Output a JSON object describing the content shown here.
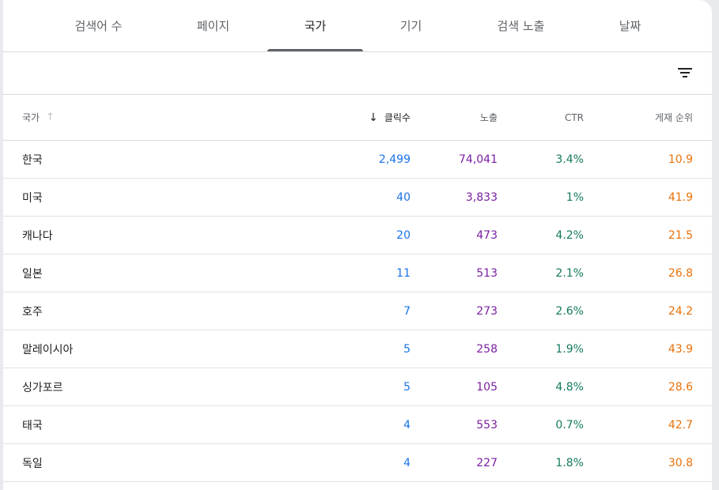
{
  "tabs": [
    {
      "label": "검색어 수"
    },
    {
      "label": "페이지"
    },
    {
      "label": "국가"
    },
    {
      "label": "기기"
    },
    {
      "label": "검색 노출"
    },
    {
      "label": "날짜"
    }
  ],
  "active_tab": "국가",
  "toolbar": {
    "filter_icon": "filter-list-icon"
  },
  "table": {
    "headers": {
      "country": "국가",
      "clicks": "클릭수",
      "impressions": "노출",
      "ctr": "CTR",
      "position": "게재 순위"
    },
    "colors": {
      "clicks": "#1a73e8",
      "impressions": "#7b1fa2",
      "ctr": "#137a5e",
      "position": "#e8710a"
    },
    "rows": [
      {
        "country": "한국",
        "clicks": "2,499",
        "impressions": "74,041",
        "ctr": "3.4%",
        "position": "10.9"
      },
      {
        "country": "미국",
        "clicks": "40",
        "impressions": "3,833",
        "ctr": "1%",
        "position": "41.9"
      },
      {
        "country": "캐나다",
        "clicks": "20",
        "impressions": "473",
        "ctr": "4.2%",
        "position": "21.5"
      },
      {
        "country": "일본",
        "clicks": "11",
        "impressions": "513",
        "ctr": "2.1%",
        "position": "26.8"
      },
      {
        "country": "호주",
        "clicks": "7",
        "impressions": "273",
        "ctr": "2.6%",
        "position": "24.2"
      },
      {
        "country": "말레이시아",
        "clicks": "5",
        "impressions": "258",
        "ctr": "1.9%",
        "position": "43.9"
      },
      {
        "country": "싱가포르",
        "clicks": "5",
        "impressions": "105",
        "ctr": "4.8%",
        "position": "28.6"
      },
      {
        "country": "태국",
        "clicks": "4",
        "impressions": "553",
        "ctr": "0.7%",
        "position": "42.7"
      },
      {
        "country": "독일",
        "clicks": "4",
        "impressions": "227",
        "ctr": "1.8%",
        "position": "30.8"
      }
    ]
  }
}
